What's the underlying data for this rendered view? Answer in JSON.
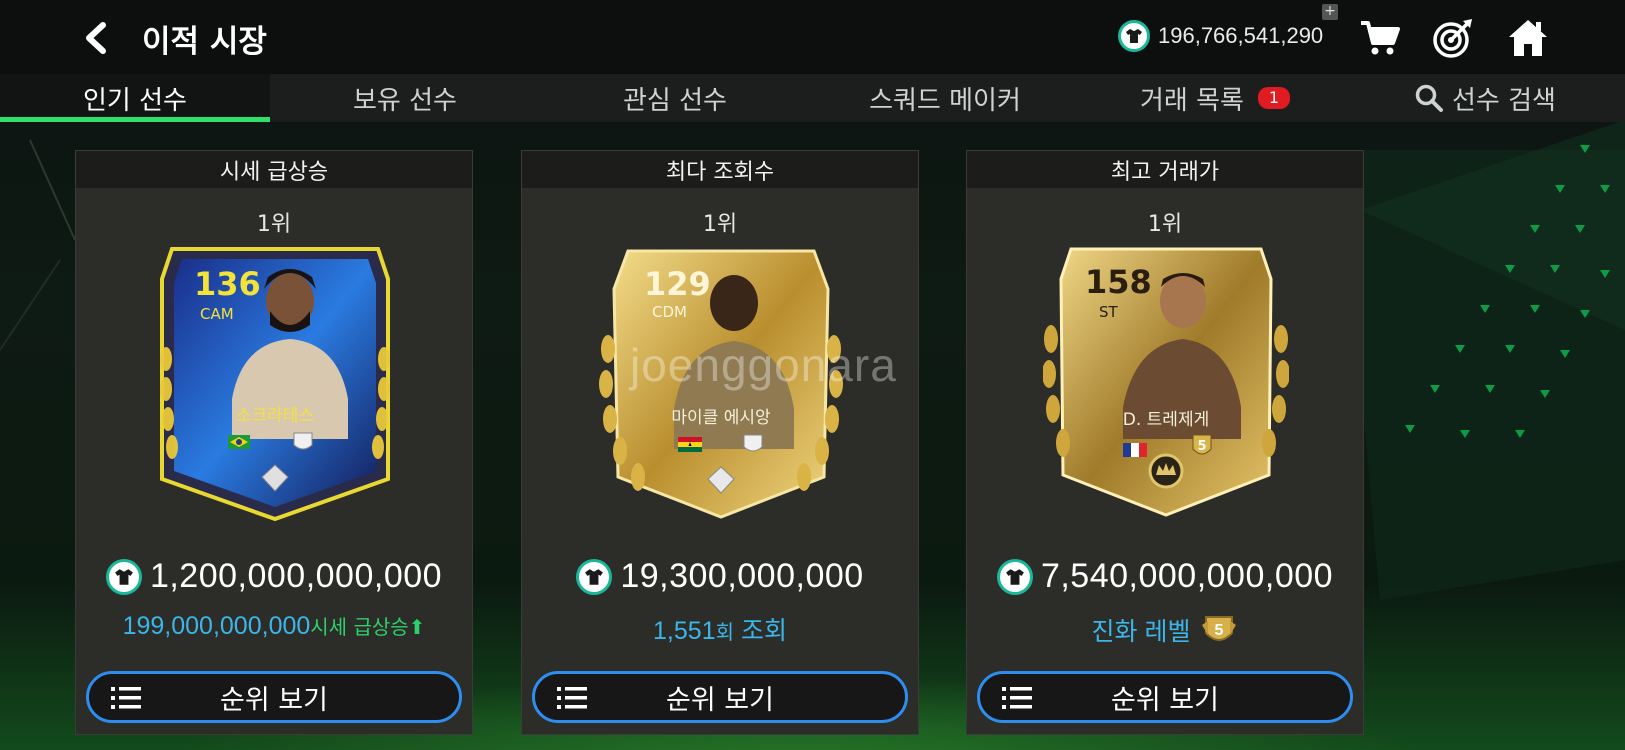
{
  "header": {
    "title": "이적 시장",
    "currency_amount": "196,766,541,290",
    "plus": "+"
  },
  "tabs": [
    {
      "label": "인기 선수",
      "active": true
    },
    {
      "label": "보유 선수",
      "active": false
    },
    {
      "label": "관심 선수",
      "active": false
    },
    {
      "label": "스쿼드 메이커",
      "active": false
    },
    {
      "label": "거래 목록",
      "active": false,
      "badge": "1"
    },
    {
      "label": "선수 검색",
      "active": false,
      "icon": "search-icon"
    }
  ],
  "panels": [
    {
      "heading": "시세 급상승",
      "rank": "1위",
      "card": {
        "rating": "136",
        "position": "CAM",
        "name": "소크라테스",
        "theme": "purple-blue"
      },
      "price": "1,200,000,000,000",
      "sub_value": "199,000,000,000",
      "sub_label": "시세 급상승",
      "sub_arrow": "⬆",
      "button": "순위 보기"
    },
    {
      "heading": "최다 조회수",
      "rank": "1위",
      "card": {
        "rating": "129",
        "position": "CDM",
        "name": "마이클 에시앙",
        "theme": "gold"
      },
      "price": "19,300,000,000",
      "sub_value": "1,551",
      "sub_unit": "회",
      "sub_label": "조회",
      "button": "순위 보기"
    },
    {
      "heading": "최고 거래가",
      "rank": "1위",
      "card": {
        "rating": "158",
        "position": "ST",
        "name": "D. 트레제게",
        "level": "5",
        "theme": "icon-gold"
      },
      "price": "7,540,000,000,000",
      "sub_label": "진화 레벨",
      "sub_level": "5",
      "button": "순위 보기"
    }
  ],
  "watermark": "joenggonara",
  "colors": {
    "accent_green": "#2ee06a",
    "button_border": "#2d8ef0",
    "sub_blue": "#3cb6e8",
    "badge_red": "#e11b22",
    "coin_teal": "#19b89a"
  }
}
